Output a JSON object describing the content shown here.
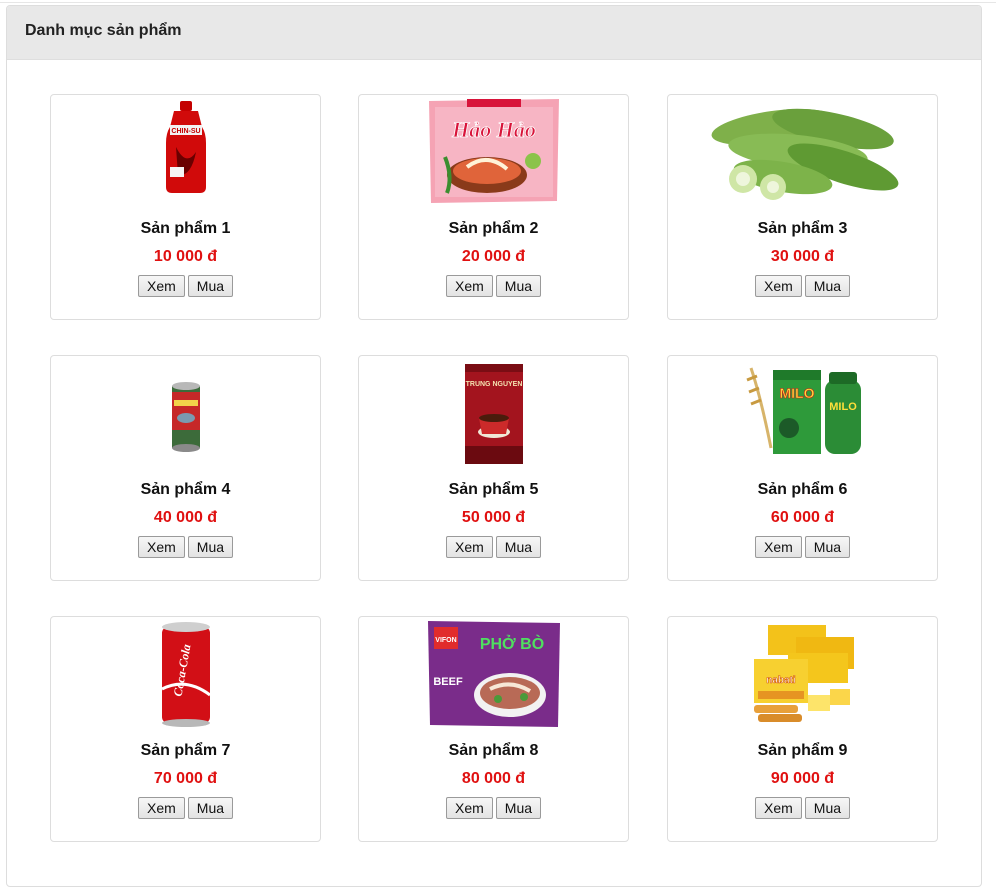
{
  "panel": {
    "title": "Danh mục sản phẩm"
  },
  "buttons": {
    "view": "Xem",
    "buy": "Mua"
  },
  "products": [
    {
      "name": "Sản phẩm 1",
      "price": "10 000 đ",
      "image": "chili-sauce-bottle",
      "image_text": "CHIN-SU"
    },
    {
      "name": "Sản phẩm 2",
      "price": "20 000 đ",
      "image": "instant-noodle-pack",
      "image_text": "Hảo Hảo"
    },
    {
      "name": "Sản phẩm 3",
      "price": "30 000 đ",
      "image": "bitter-melon"
    },
    {
      "name": "Sản phẩm 4",
      "price": "40 000 đ",
      "image": "canned-fish"
    },
    {
      "name": "Sản phẩm 5",
      "price": "50 000 đ",
      "image": "coffee-box",
      "image_text": "TRUNG NGUYEN"
    },
    {
      "name": "Sản phẩm 6",
      "price": "60 000 đ",
      "image": "milo-box-and-jar",
      "image_text": "MILO"
    },
    {
      "name": "Sản phẩm 7",
      "price": "70 000 đ",
      "image": "soda-can",
      "image_text": "Coca-Cola"
    },
    {
      "name": "Sản phẩm 8",
      "price": "80 000 đ",
      "image": "pho-noodle-pack",
      "image_text": "PHỞ BÒ"
    },
    {
      "name": "Sản phẩm 9",
      "price": "90 000 đ",
      "image": "wafer-boxes",
      "image_text": "nabati"
    }
  ],
  "colors": {
    "price": "#e01010",
    "heading_bg": "#e8e8e8",
    "card_border": "#dddddd"
  }
}
